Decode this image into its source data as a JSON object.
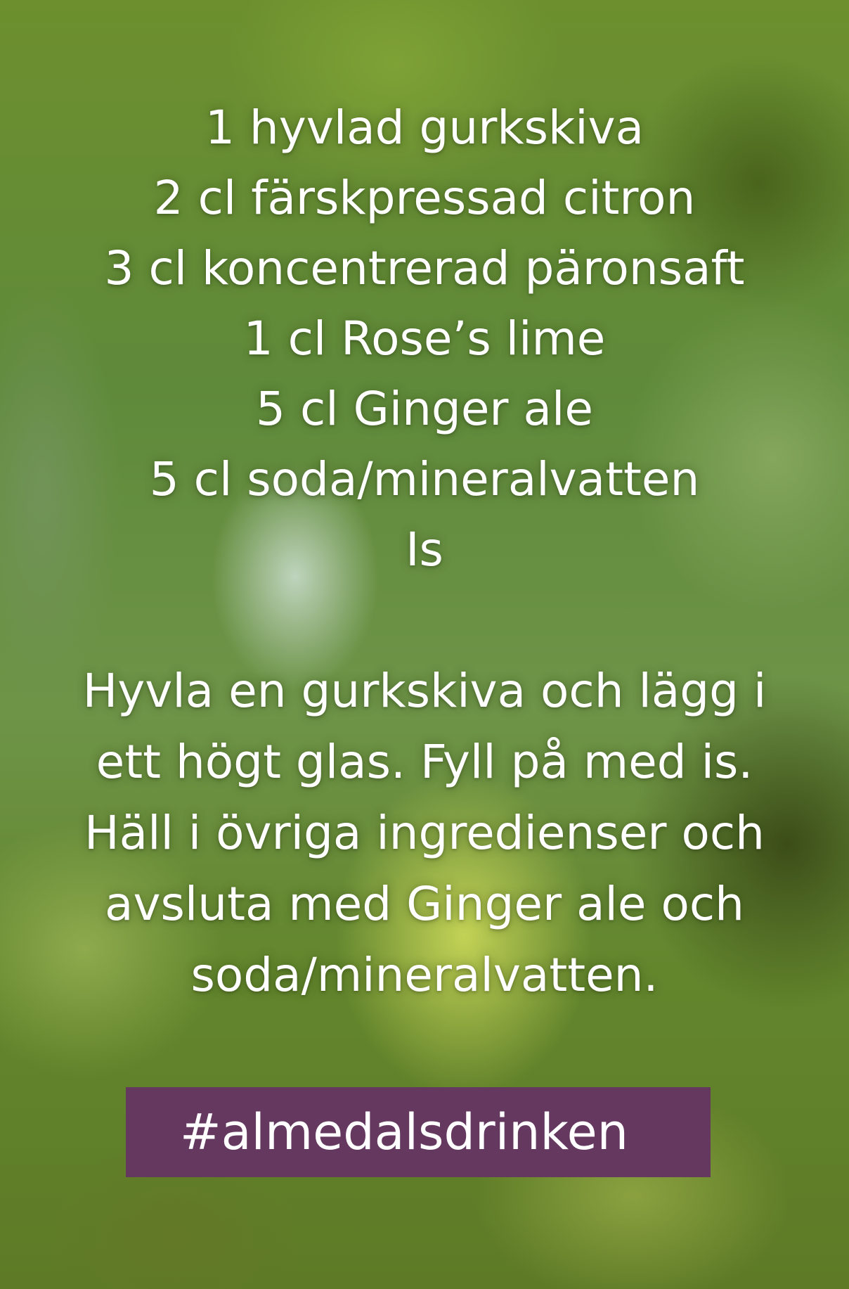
{
  "ingredients": [
    "1 hyvlad gurkskiva",
    "2 cl färskpressad citron",
    "3 cl koncentrerad päronsaft",
    "1 cl Rose’s lime",
    "5 cl Ginger ale",
    "5 cl soda/mineralvatten",
    "Is"
  ],
  "instructions": [
    "Hyvla en gurkskiva och lägg i",
    "ett högt glas. Fyll på med is.",
    "Häll i övriga ingredienser och",
    "avsluta med Ginger ale och",
    "soda/mineralvatten."
  ],
  "hashtag": "#almedalsdrinken",
  "colors": {
    "hashtag_background": "#653860",
    "text": "#ffffff"
  }
}
